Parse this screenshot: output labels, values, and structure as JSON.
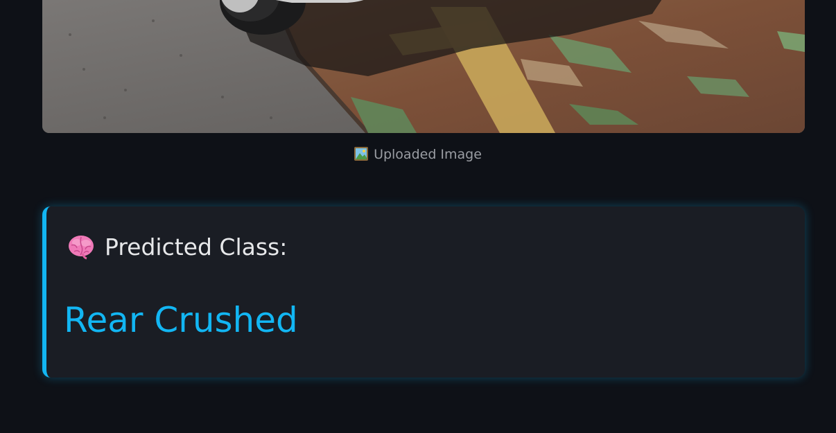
{
  "uploaded_image": {
    "caption_icon": "framed-picture-icon",
    "caption": "Uploaded Image"
  },
  "result": {
    "heading_icon": "brain-icon",
    "heading": "Predicted Class:",
    "predicted_class": "Rear Crushed"
  },
  "colors": {
    "background": "#0e1117",
    "card_background": "#1a1d24",
    "accent": "#12b6f3",
    "heading_text": "#e7e8ea",
    "caption_text": "#9a9da3"
  }
}
